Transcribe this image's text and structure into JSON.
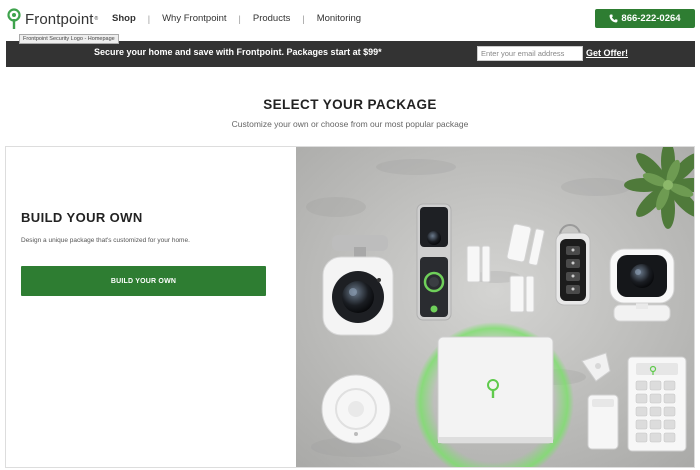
{
  "header": {
    "logo_text": "Frontpoint",
    "logo_tm": "®",
    "logo_tooltip": "Frontpoint Security Logo - Homepage",
    "nav": [
      {
        "label": "Shop"
      },
      {
        "label": "Why Frontpoint"
      },
      {
        "label": "Products"
      },
      {
        "label": "Monitoring"
      }
    ],
    "phone": "866-222-0264"
  },
  "promo": {
    "text": "Secure your home and save with Frontpoint. Packages start at $99*",
    "email_placeholder": "Enter your email address",
    "cta": "Get Offer!"
  },
  "section": {
    "title": "SELECT YOUR PACKAGE",
    "subtitle": "Customize your own or choose from our most popular package"
  },
  "build": {
    "heading": "BUILD YOUR OWN",
    "description": "Design a unique package that's customized for your home.",
    "button": "BUILD YOUR OWN"
  },
  "colors": {
    "brand_green": "#2e7d32",
    "promo_bg": "#333333"
  }
}
